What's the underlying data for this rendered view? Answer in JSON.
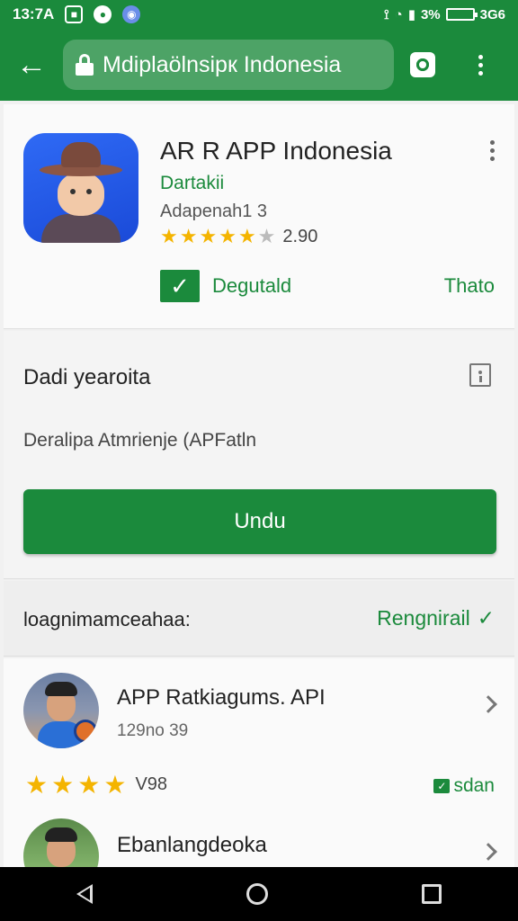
{
  "status_bar": {
    "time": "13:7A",
    "right_text": "3%",
    "battery_text": "3G6"
  },
  "toolbar": {
    "url": "Mdiplaölnsipк Indonesia",
    "theme_color": "#1b8a3c"
  },
  "app": {
    "title": "AR R APP Indonesia",
    "developer": "Dartakii",
    "meta": "Adapenah1 3",
    "rating_value": "2.90",
    "stars_filled": 5,
    "installed_label": "Degutald",
    "side_link": "Thato"
  },
  "info": {
    "title": "Dadi yearoita",
    "description": "Deralipa Atmrienje (APFatln",
    "download_label": "Undu"
  },
  "reviews": {
    "title": "loagnimamceahaa:",
    "link_label": "Rengnirail",
    "items": [
      {
        "name": "APP Ratkiagums. API",
        "date": "129no 39",
        "score": "V98",
        "tag": "sdan"
      },
      {
        "name": "Ebanlangdeoka"
      }
    ]
  },
  "icons": {
    "back": "arrow-left-icon",
    "lock": "lock-icon",
    "camera": "camera-icon",
    "overflow": "more-vert-icon"
  }
}
